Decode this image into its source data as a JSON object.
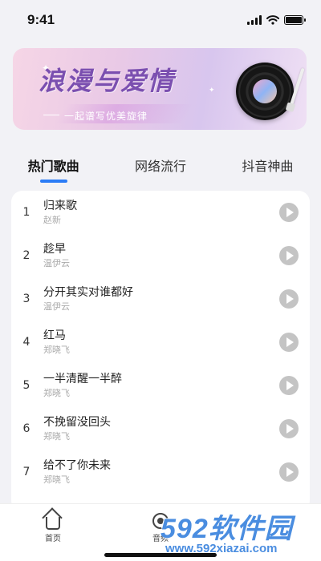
{
  "status": {
    "time": "9:41"
  },
  "banner": {
    "title": "浪漫与爱情",
    "subtitle": "一起谱写优美旋律"
  },
  "tabs": [
    {
      "label": "热门歌曲",
      "active": true
    },
    {
      "label": "网络流行",
      "active": false
    },
    {
      "label": "抖音神曲",
      "active": false
    }
  ],
  "songs": [
    {
      "num": "1",
      "title": "归来歌",
      "artist": "赵新"
    },
    {
      "num": "2",
      "title": "趁早",
      "artist": "温伊云"
    },
    {
      "num": "3",
      "title": "分开其实对谁都好",
      "artist": "温伊云"
    },
    {
      "num": "4",
      "title": "红马",
      "artist": "郑晓飞"
    },
    {
      "num": "5",
      "title": "一半清醒一半醉",
      "artist": "郑晓飞"
    },
    {
      "num": "6",
      "title": "不挽留没回头",
      "artist": "郑晓飞"
    },
    {
      "num": "7",
      "title": "给不了你未来",
      "artist": "郑晓飞"
    }
  ],
  "nav": {
    "home_label": "首页",
    "audio_label": "音频"
  },
  "watermark": {
    "main": "592软件园",
    "url": "www.592xiazai.com"
  },
  "colors": {
    "accent": "#2b7cf6",
    "play_button": "#c4c4c4",
    "watermark": "#4a8de0"
  }
}
